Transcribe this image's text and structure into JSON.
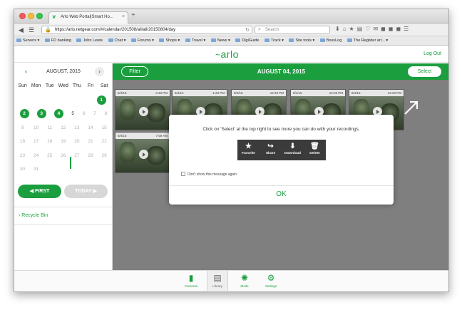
{
  "browser": {
    "tab_title": "Arlo Web Portal|Smart Ho...",
    "tab_close": "×",
    "new_tab": "+",
    "url": "https://arlo.netgear.com/#/calendar/201508/all/all/20150804/day",
    "search_placeholder": "Search",
    "bookmarks": [
      "Servers ▾",
      "FD banking",
      "John Lewis",
      "Chat ▾",
      "Forums ▾",
      "Shops ▾",
      "Travel ▾",
      "News ▾",
      "DigiGuide",
      "Track ▾",
      "Site tools ▾",
      "BossLog",
      "The Register art... ▾"
    ]
  },
  "header": {
    "logo": "arlo",
    "logout": "Log Out"
  },
  "calendar": {
    "month_label": "AUGUST, 2015",
    "prev": "‹",
    "next": "›",
    "weekdays": [
      "Sun",
      "Mon",
      "Tue",
      "Wed",
      "Thu",
      "Fri",
      "Sat"
    ],
    "weeks": [
      [
        "",
        "",
        "",
        "",
        "",
        "",
        "1"
      ],
      [
        "2",
        "3",
        "4",
        "5",
        "6",
        "7",
        "8"
      ],
      [
        "9",
        "10",
        "11",
        "12",
        "13",
        "14",
        "15"
      ],
      [
        "16",
        "17",
        "18",
        "19",
        "20",
        "21",
        "22"
      ],
      [
        "23",
        "24",
        "25",
        "26",
        "27",
        "28",
        "29"
      ],
      [
        "30",
        "31",
        "",
        "",
        "",
        "",
        ""
      ]
    ],
    "active_days": [
      "1",
      "2",
      "3",
      "4"
    ],
    "first_button": "◀ FIRST",
    "today_button": "TODAY ▶",
    "recycle_bin": "› Recycle Bin"
  },
  "toolbar": {
    "filter": "Filter",
    "date": "AUGUST 04, 2015",
    "select": "Select"
  },
  "recordings": [
    {
      "date": "8/4/15",
      "time": "2:33 PM"
    },
    {
      "date": "8/4/15",
      "time": "1:23 PM"
    },
    {
      "date": "8/4/15",
      "time": "12:49 PM"
    },
    {
      "date": "8/4/15",
      "time": "12:28 PM"
    },
    {
      "date": "8/4/15",
      "time": "12:20 PM"
    },
    {
      "date": "8/4/15",
      "time": "7:59 AM"
    }
  ],
  "modal": {
    "text": "Click on 'Select' at the top right to see more you can do with your recordings.",
    "actions": [
      {
        "icon": "star-icon",
        "label": "Favorite"
      },
      {
        "icon": "share-icon",
        "label": "Share"
      },
      {
        "icon": "download-icon",
        "label": "Download"
      },
      {
        "icon": "trash-icon",
        "label": "Delete"
      }
    ],
    "checkbox_label": "Don't show this message again",
    "ok": "OK"
  },
  "bottom_nav": [
    {
      "icon": "camera-icon",
      "label": "Cameras"
    },
    {
      "icon": "library-icon",
      "label": "Library"
    },
    {
      "icon": "mode-icon",
      "label": "Mode"
    },
    {
      "icon": "settings-icon",
      "label": "Settings"
    }
  ],
  "colors": {
    "brand_green": "#1b9e3e",
    "overlay_gray": "#7f7f7f"
  }
}
